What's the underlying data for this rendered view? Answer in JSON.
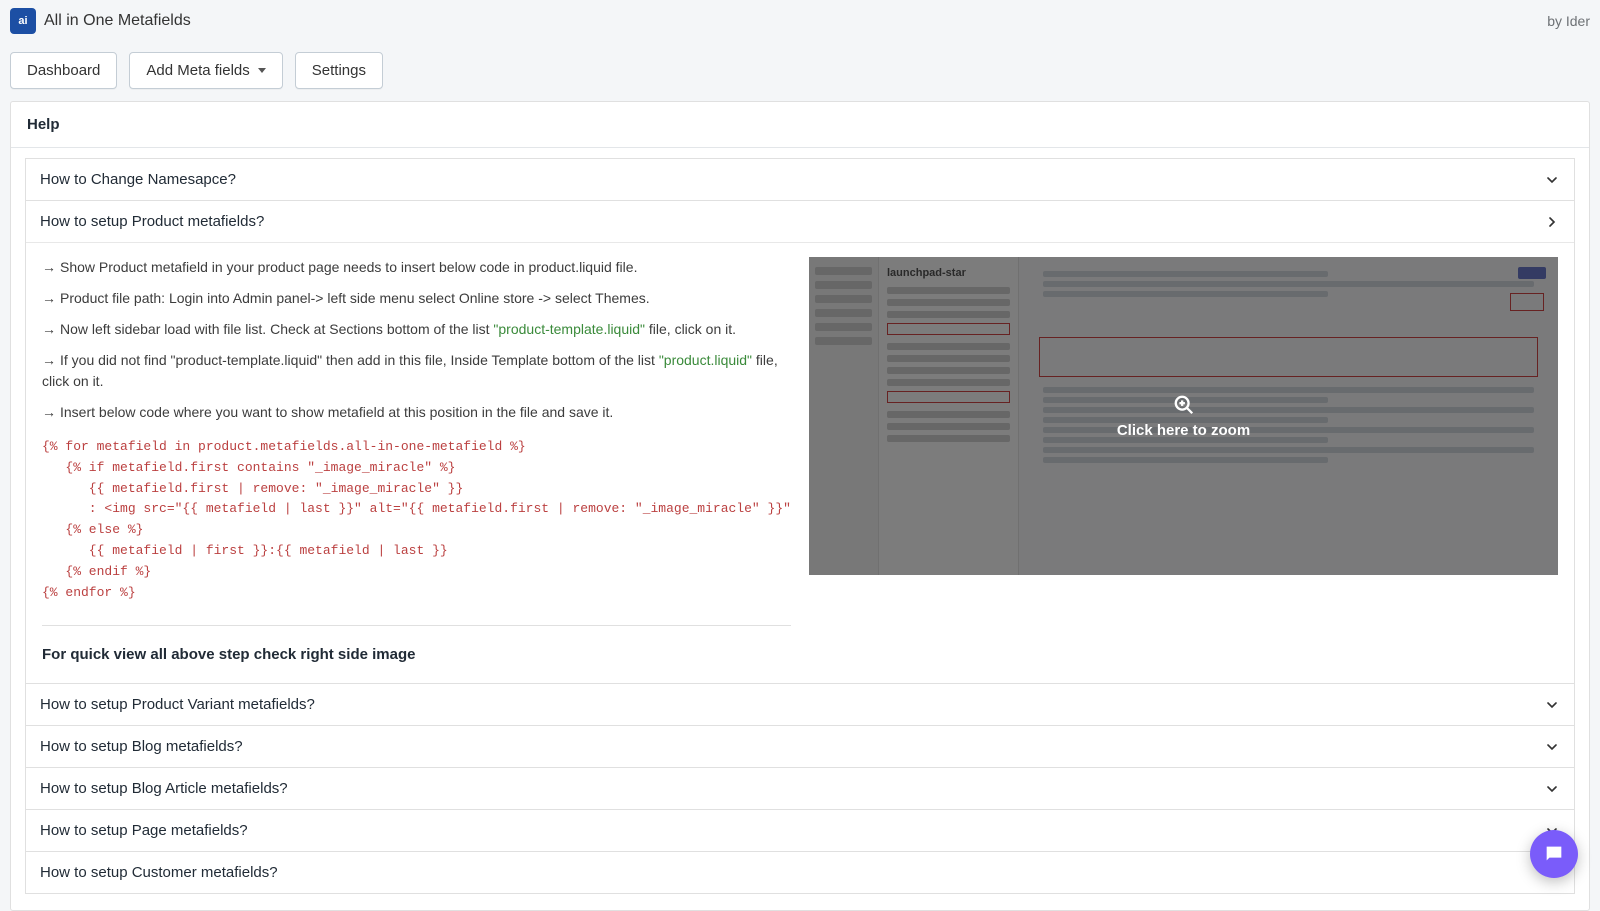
{
  "app": {
    "title": "All in One Metafields",
    "byline": "by Ider"
  },
  "nav": {
    "dashboard": "Dashboard",
    "addMeta": "Add Meta fields",
    "settings": "Settings"
  },
  "panel": {
    "title": "Help"
  },
  "accordions": {
    "namespace": "How to Change Namesapce?",
    "product": "How to setup Product metafields?",
    "variant": "How to setup Product Variant metafields?",
    "blog": "How to setup Blog metafields?",
    "article": "How to setup Blog Article metafields?",
    "page": "How to setup Page metafields?",
    "customer": "How to setup Customer metafields?"
  },
  "productHelp": {
    "steps": {
      "s1": "Show Product metafield in your product page needs to insert below code in product.liquid file.",
      "s2": "Product file path: Login into Admin panel-> left side menu select Online store -> select Themes.",
      "s3a": "Now left sidebar load with file list. Check at Sections bottom of the list ",
      "s3link": "\"product-template.liquid\"",
      "s3b": " file, click on it.",
      "s4a": "If you did not find \"product-template.liquid\" then add in this file, Inside Template bottom of the list ",
      "s4link": "\"product.liquid\"",
      "s4b": " file, click on it.",
      "s5": "Insert below code where you want to show metafield at this position in the file and save it."
    },
    "code": "{% for metafield in product.metafields.all-in-one-metafield %}\n   {% if metafield.first contains \"_image_miracle\" %}\n      {{ metafield.first | remove: \"_image_miracle\" }}\n      : <img src=\"{{ metafield | last }}\" alt=\"{{ metafield.first | remove: \"_image_miracle\" }}\">\n   {% else %}\n      {{ metafield | first }}:{{ metafield | last }}\n   {% endif %}\n{% endfor %}",
    "note": "For quick view all above step check right side image",
    "zoom": "Click here to zoom",
    "screenshotTitle": "launchpad-star"
  }
}
